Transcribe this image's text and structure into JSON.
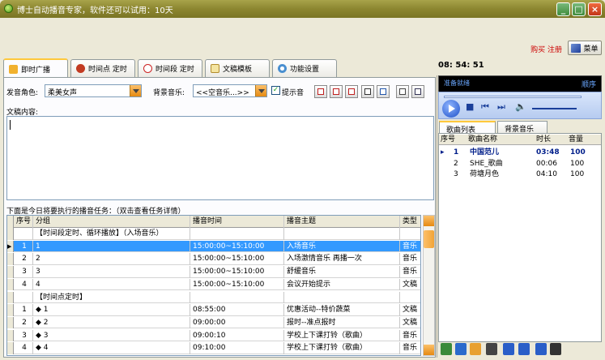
{
  "window": {
    "title": "博士自动播音专家，软件还可以试用：10天"
  },
  "header": {
    "buy": "购买",
    "register": "注册",
    "menu_label": "菜单"
  },
  "tabs": [
    {
      "label": "即时广播"
    },
    {
      "label": "时间点 定时"
    },
    {
      "label": "时间段 定时"
    },
    {
      "label": "文稿模板"
    },
    {
      "label": "功能设置"
    }
  ],
  "broadcast": {
    "voice_label": "发音角色:",
    "voice_value": "柔美女声",
    "bgm_label": "背景音乐:",
    "bgm_value": "<<空音乐...>>",
    "prompt_label": "提示音",
    "prompt_checked": true,
    "content_label": "文稿内容:",
    "content_value": ""
  },
  "tasks": {
    "caption": "下面是今日将要执行的播音任务：（双击查看任务详情）",
    "columns": [
      "序号",
      "分组",
      "播音时间",
      "播音主题",
      "类型"
    ],
    "rows": [
      {
        "no": "",
        "group": "【时间段定时、循环播放】（入场音乐）",
        "time": "",
        "topic": "",
        "type": ""
      },
      {
        "no": "1",
        "group": "1",
        "time": "15:00:00~15:10:00",
        "topic": "入场音乐",
        "type": "音乐"
      },
      {
        "no": "2",
        "group": "2",
        "time": "15:00:00~15:10:00",
        "topic": "入场激情音乐 再播一次",
        "type": "音乐"
      },
      {
        "no": "3",
        "group": "3",
        "time": "15:00:00~15:10:00",
        "topic": "舒缓音乐",
        "type": "音乐"
      },
      {
        "no": "4",
        "group": "4",
        "time": "15:00:00~15:10:00",
        "topic": "会议开始提示",
        "type": "文稿"
      },
      {
        "no": "",
        "group": "【时间点定时】",
        "time": "",
        "topic": "",
        "type": ""
      },
      {
        "no": "1",
        "group": "◆ 1",
        "time": "08:55:00",
        "topic": "优惠活动--特价蔬菜",
        "type": "文稿"
      },
      {
        "no": "2",
        "group": "◆ 2",
        "time": "09:00:00",
        "topic": "报时--准点报时",
        "type": "文稿"
      },
      {
        "no": "3",
        "group": "◆ 3",
        "time": "09:00:10",
        "topic": "学校上下课打铃（歌曲）",
        "type": "音乐"
      },
      {
        "no": "4",
        "group": "◆ 4",
        "time": "09:10:00",
        "topic": "学校上下课打铃（歌曲）",
        "type": "音乐"
      }
    ],
    "selected_row": 1
  },
  "clock": "08: 54: 51",
  "player": {
    "status": "准备就绪",
    "mode": "顺序"
  },
  "song_tabs": [
    {
      "label": "歌曲列表"
    },
    {
      "label": "背景音乐"
    }
  ],
  "songs": {
    "columns": [
      "序号",
      "歌曲名称",
      "时长",
      "音量"
    ],
    "rows": [
      {
        "no": "1",
        "name": "中国范儿",
        "duration": "03:48",
        "volume": "100"
      },
      {
        "no": "2",
        "name": "SHE_歌曲",
        "duration": "00:06",
        "volume": "100"
      },
      {
        "no": "3",
        "name": "荷塘月色",
        "duration": "04:10",
        "volume": "100"
      }
    ],
    "current_row": 0
  },
  "colors": {
    "titlebar": "#8c8630",
    "selection": "#3399ff",
    "accent": "#ffc83c"
  }
}
